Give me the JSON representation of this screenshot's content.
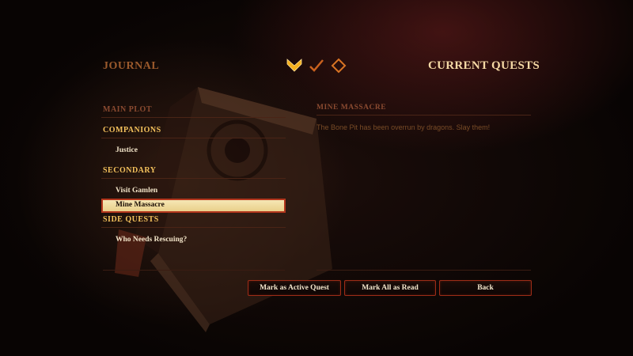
{
  "header": {
    "journal_title": "JOURNAL",
    "section_title": "CURRENT QUESTS",
    "tabs": [
      {
        "icon": "active-quests-chevron-icon",
        "selected": true
      },
      {
        "icon": "completed-checkmark-icon",
        "selected": false
      },
      {
        "icon": "diamond-icon",
        "selected": false
      }
    ]
  },
  "quest_list": {
    "main_plot": "MAIN PLOT",
    "companions": "COMPANIONS",
    "companions_items": [
      "Justice"
    ],
    "secondary": "SECONDARY",
    "secondary_items": [
      "Visit Gamlen",
      "Mine Massacre"
    ],
    "side_quests": "SIDE QUESTS",
    "side_quests_items": [
      "Who Needs Rescuing?"
    ]
  },
  "detail": {
    "title": "MINE MASSACRE",
    "description": "The Bone Pit has been overrun by dragons. Slay them!"
  },
  "buttons": {
    "mark_active": "Mark as Active Quest",
    "mark_all_read": "Mark All as Read",
    "back": "Back"
  },
  "colors": {
    "accent_gold": "#f3c15c",
    "button_border": "#9d2c17",
    "selected_row_bg": "#f6e7b4"
  }
}
